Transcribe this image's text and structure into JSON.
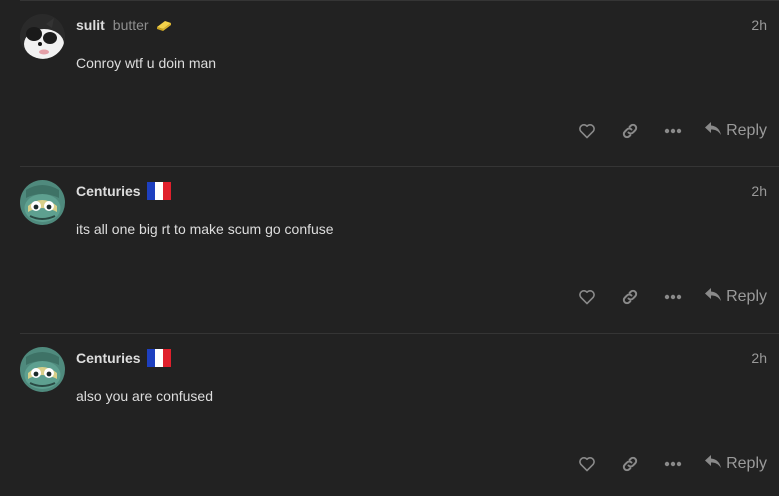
{
  "theme": {
    "background": "#222222",
    "text": "#dddddd",
    "muted": "#9a9a9a",
    "icon": "#8a8a8a"
  },
  "posts": [
    {
      "username": "sulit",
      "user_title": "butter",
      "flair_icon": "butter-icon",
      "time": "2h",
      "body": "Conroy wtf u doin man",
      "reply_label": "Reply",
      "avatar": "cat-avatar"
    },
    {
      "username": "Centuries",
      "user_title": "",
      "flair_icon": "france-flag-icon",
      "time": "2h",
      "body": "its all one big rt to make scum go confuse",
      "reply_label": "Reply",
      "avatar": "creature-avatar"
    },
    {
      "username": "Centuries",
      "user_title": "",
      "flair_icon": "france-flag-icon",
      "time": "2h",
      "body": "also you are confused",
      "reply_label": "Reply",
      "avatar": "creature-avatar"
    }
  ]
}
